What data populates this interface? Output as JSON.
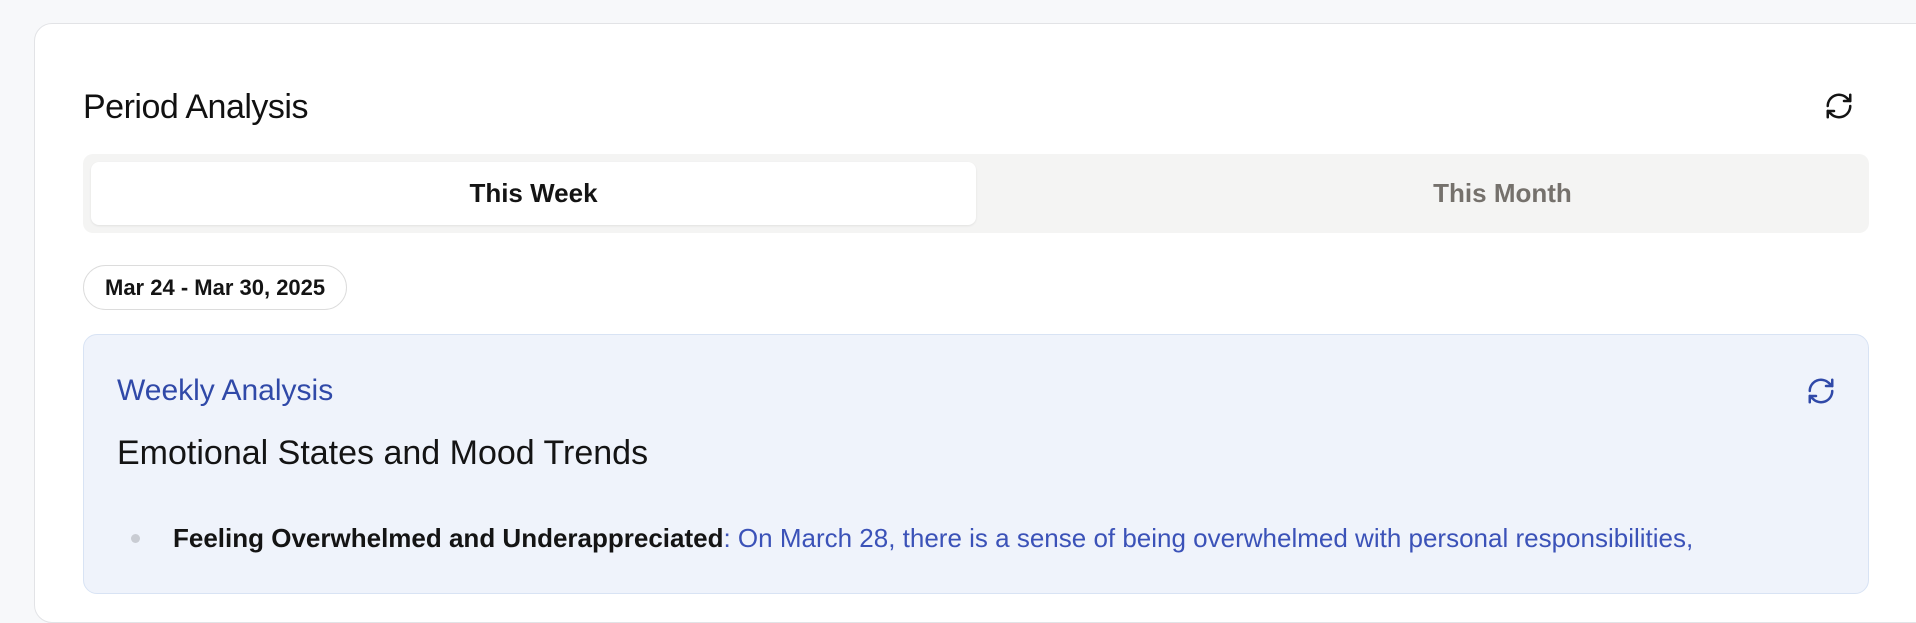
{
  "header": {
    "title": "Period Analysis",
    "refresh_icon": "refresh-icon"
  },
  "tabs": [
    {
      "label": "This Week",
      "active": true
    },
    {
      "label": "This Month",
      "active": false
    }
  ],
  "date_range": "Mar 24 - Mar 30, 2025",
  "analysis": {
    "label": "Weekly Analysis",
    "refresh_icon": "refresh-icon",
    "heading": "Emotional States and Mood Trends",
    "items": [
      {
        "title": "Feeling Overwhelmed and Underappreciated",
        "body": ": On March 28, there is a sense of being overwhelmed with personal responsibilities,"
      }
    ]
  },
  "colors": {
    "accent_blue": "#3049a8",
    "analysis_bg": "#eff3fb",
    "tab_bg": "#f4f4f3",
    "inactive_tab_text": "#75716c"
  }
}
